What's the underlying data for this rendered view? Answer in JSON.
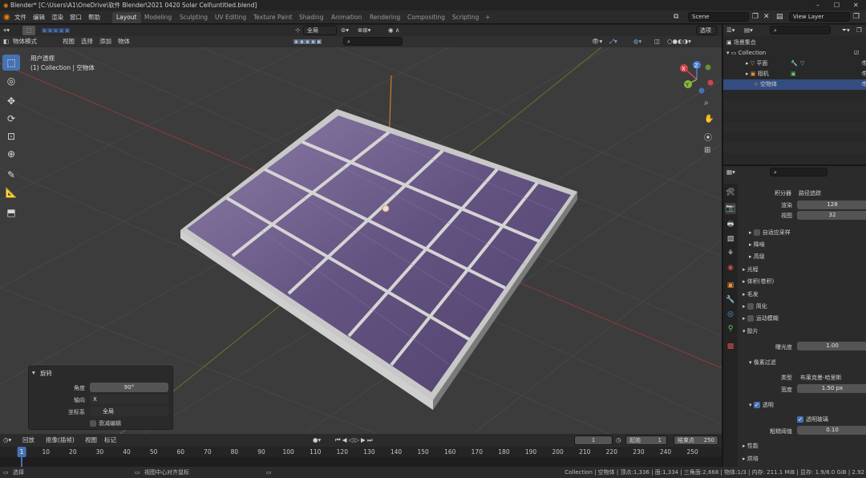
{
  "window": {
    "title": "Blender* [C:\\Users\\A1\\OneDrive\\软件 Blender\\2021 0420 Solar Cell\\untitled.blend]",
    "controls": [
      "–",
      "☐",
      "✕"
    ]
  },
  "menu": {
    "items": [
      "文件",
      "编辑",
      "渲染",
      "窗口",
      "帮助"
    ],
    "workspaces": [
      "Layout",
      "Modeling",
      "Sculpting",
      "UV Editing",
      "Texture Paint",
      "Shading",
      "Animation",
      "Rendering",
      "Compositing",
      "Scripting"
    ],
    "add_workspace": "+",
    "scene": "Scene",
    "view_layer": "View Layer"
  },
  "viewport_header": {
    "mode": "物体模式",
    "menus": [
      "视图",
      "选择",
      "添加",
      "物体"
    ],
    "orientation": "全局",
    "options": "选项"
  },
  "viewport": {
    "view_name": "用户透视",
    "collection_path": "(1) Collection | 空物体",
    "gizmo_axes": [
      "X",
      "Y",
      "Z"
    ]
  },
  "redo_panel": {
    "title": "旋转",
    "angle_label": "角度",
    "angle_value": "90°",
    "axis_label": "轴向",
    "axis_value": "X",
    "orient_label": "坐标系",
    "orient_value": "全局",
    "proportional": "衰减编辑"
  },
  "outliner": {
    "root": "场景集合",
    "collection": "Collection",
    "items": [
      "平面",
      "相机",
      "空物体"
    ],
    "search_placeholder": ""
  },
  "properties": {
    "integrator_label": "积分器",
    "integrator_value": "路径追踪",
    "render_label": "渲染",
    "render_value": "128",
    "viewport_label": "视图",
    "viewport_value": "32",
    "sections": [
      "自适应采样",
      "降噪",
      "高级",
      "光程",
      "体积(卷积)",
      "毛发",
      "简化",
      "运动模糊",
      "胶片"
    ],
    "exposure_label": "曝光度",
    "exposure_value": "1.00",
    "pixel_filter": "像素过滤",
    "type_label": "类型",
    "type_value": "布莱克曼-哈里斯",
    "width_label": "宽度",
    "width_value": "1.50 px",
    "transparent": "透明",
    "transparent_glass": "透明玻璃",
    "roughness_label": "粗糙阈值",
    "roughness_value": "0.10",
    "performance": "性能",
    "bake": "烘培"
  },
  "timeline": {
    "menus": [
      "回放",
      "抠像(插帧)",
      "视图",
      "标记"
    ],
    "current_frame": "1",
    "start_label": "起始",
    "start_value": "1",
    "end_label": "结束点",
    "end_value": "250",
    "ticks": [
      "1",
      "10",
      "20",
      "30",
      "40",
      "50",
      "60",
      "70",
      "80",
      "90",
      "100",
      "110",
      "120",
      "130",
      "140",
      "150",
      "160",
      "170",
      "180",
      "190",
      "200",
      "210",
      "220",
      "230",
      "240",
      "250"
    ]
  },
  "status": {
    "left": "选择",
    "middle": "视图中心对齐鼠标",
    "right": "Collection | 空物体 | 顶点:1,336 | 面:1,334 | 三角面:2,668 | 物体:1/3 | 内存: 211.1 MiB | 显存: 1.9/8.0 GiB | 2.92"
  },
  "colors": {
    "accent": "#4772b3",
    "panel_cell": "#5a4a78",
    "grid_x": "#a44a4a",
    "grid_y": "#6f8a35"
  }
}
